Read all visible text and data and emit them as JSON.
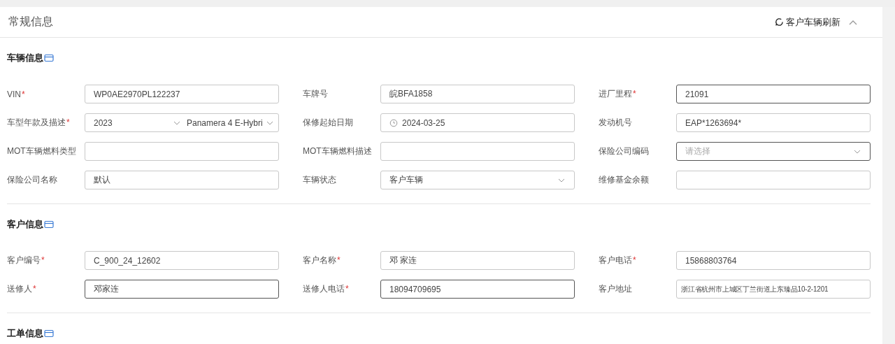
{
  "panel": {
    "title": "常规信息",
    "refresh_label": "客户车辆刷新",
    "expanded": true
  },
  "sections": [
    {
      "title": "车辆信息",
      "rows": [
        [
          {
            "label": "VIN",
            "mark": "*",
            "kind": "text",
            "value": "WP0AE2970PL122237",
            "emphasized": false
          },
          {
            "label": "车牌号",
            "kind": "text",
            "value": "皖BFA1858",
            "emphasized": false
          },
          {
            "label": "进厂里程",
            "mark": "*",
            "kind": "text",
            "value": "21091",
            "emphasized": true
          }
        ],
        [
          {
            "label": "车型年款及描述",
            "mark": "*",
            "kind": "dual-select",
            "values": [
              "2023",
              "Panamera 4 E-Hybri"
            ],
            "emphasized": false
          },
          {
            "label": "保修起始日期",
            "kind": "date",
            "value": "2024-03-25",
            "emphasized": false
          },
          {
            "label": "发动机号",
            "kind": "text",
            "value": "EAP*1263694*",
            "emphasized": false
          }
        ],
        [
          {
            "label": "MOT车辆燃料类型",
            "kind": "text",
            "emphasized": false
          },
          {
            "label": "MOT车辆燃料描述",
            "kind": "text",
            "emphasized": false
          },
          {
            "label": "保险公司编码",
            "kind": "select",
            "placeholder": "请选择",
            "emphasized": true
          }
        ],
        [
          {
            "label": "保险公司名称",
            "kind": "text",
            "value": "默认",
            "emphasized": false
          },
          {
            "label": "车辆状态",
            "kind": "select",
            "value": "客户车辆",
            "emphasized": false
          },
          {
            "label": "维修基金余额",
            "kind": "text",
            "emphasized": false
          }
        ]
      ]
    },
    {
      "title": "客户信息",
      "rows": [
        [
          {
            "label": "客户编号",
            "mark": "*",
            "kind": "text",
            "value": "C_900_24_12602",
            "emphasized": false
          },
          {
            "label": "客户名称",
            "mark": "*",
            "kind": "text",
            "value": "邓 家连",
            "emphasized": false
          },
          {
            "label": "客户电话",
            "mark": "*",
            "kind": "text",
            "value": "15868803764",
            "emphasized": false
          }
        ],
        [
          {
            "label": "送修人",
            "mark": "*",
            "kind": "text",
            "value": "邓家连",
            "emphasized": true
          },
          {
            "label": "送修人电话",
            "mark": "*",
            "kind": "text",
            "value": "18094709695",
            "emphasized": true
          },
          {
            "label": "客户地址",
            "kind": "text",
            "value": "浙江省杭州市上城区丁兰街道上东臻品10-2-1201",
            "emphasized": false
          }
        ]
      ]
    },
    {
      "title": "工单信息"
    }
  ]
}
